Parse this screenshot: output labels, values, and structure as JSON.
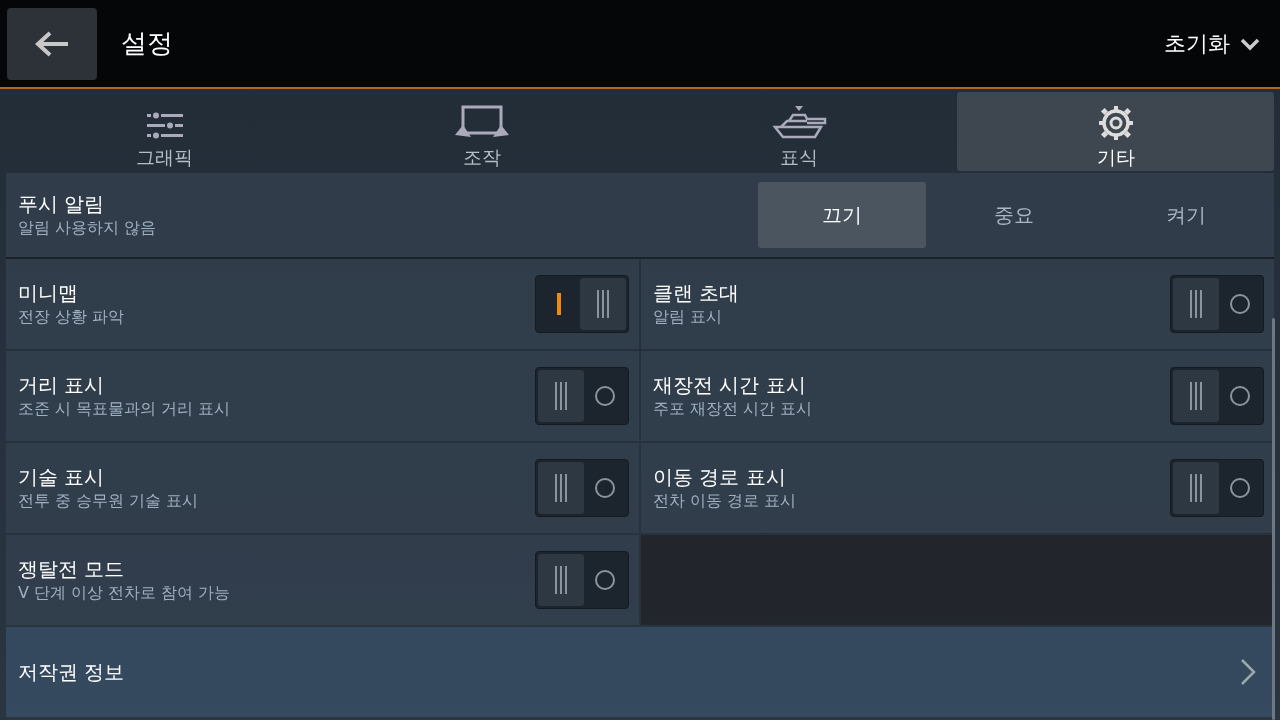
{
  "header": {
    "title": "설정",
    "reset_label": "초기화"
  },
  "tabs": [
    {
      "label": "그래픽",
      "selected": false
    },
    {
      "label": "조작",
      "selected": false
    },
    {
      "label": "표식",
      "selected": false
    },
    {
      "label": "기타",
      "selected": true
    }
  ],
  "push": {
    "title": "푸시 알림",
    "subtitle": "알림 사용하지 않음",
    "options": [
      {
        "label": "끄기",
        "selected": true
      },
      {
        "label": "중요",
        "selected": false
      },
      {
        "label": "켜기",
        "selected": false
      }
    ]
  },
  "settings": [
    {
      "title": "미니맵",
      "subtitle": "전장 상황 파악",
      "on": true
    },
    {
      "title": "클랜 초대",
      "subtitle": "알림 표시",
      "on": false
    },
    {
      "title": "거리 표시",
      "subtitle": "조준 시 목표물과의 거리 표시",
      "on": false
    },
    {
      "title": "재장전 시간 표시",
      "subtitle": "주포 재장전 시간 표시",
      "on": false
    },
    {
      "title": "기술 표시",
      "subtitle": "전투 중 승무원 기술 표시",
      "on": false
    },
    {
      "title": "이동 경로 표시",
      "subtitle": "전차 이동 경로 표시",
      "on": false
    },
    {
      "title": "쟁탈전 모드",
      "subtitle": "V 단계 이상 전차로 참여 가능",
      "on": false
    }
  ],
  "copyright": {
    "label": "저작권 정보"
  }
}
